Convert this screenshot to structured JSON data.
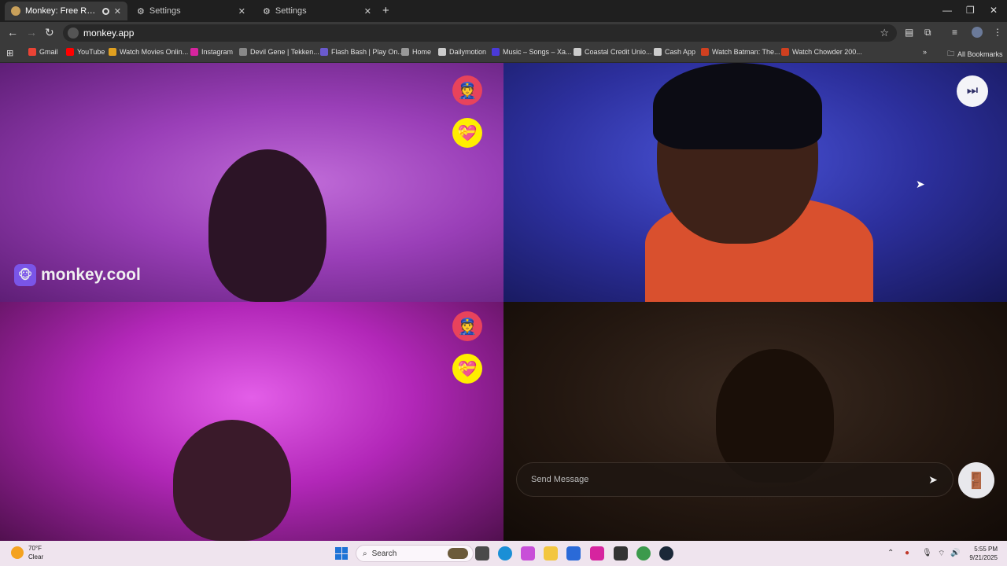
{
  "browser": {
    "tabs": [
      {
        "title": "Monkey: Free Random Vid",
        "active": true
      },
      {
        "title": "Settings",
        "active": false
      },
      {
        "title": "Settings",
        "active": false
      }
    ],
    "url": "monkey.app",
    "bookmarks": [
      {
        "label": "Gmail",
        "color": "#ea4335"
      },
      {
        "label": "YouTube",
        "color": "#ff0000"
      },
      {
        "label": "Watch Movies Onlin...",
        "color": "#e0a020"
      },
      {
        "label": "Instagram",
        "color": "#d6249f"
      },
      {
        "label": "Devil Gene | Tekken...",
        "color": "#888888"
      },
      {
        "label": "Flash Bash | Play On...",
        "color": "#6a5acd"
      },
      {
        "label": "Home",
        "color": "#999999"
      },
      {
        "label": "Dailymotion",
        "color": "#cccccc"
      },
      {
        "label": "Music – Songs – Xa...",
        "color": "#4a3ad8"
      },
      {
        "label": "Coastal Credit Unio...",
        "color": "#cccccc"
      },
      {
        "label": "Cash App",
        "color": "#cccccc"
      },
      {
        "label": "Watch Batman: The...",
        "color": "#d04020"
      },
      {
        "label": "Watch Chowder 200...",
        "color": "#d04020"
      }
    ],
    "all_bookmarks_label": "All Bookmarks"
  },
  "app": {
    "watermark": "monkey.cool",
    "chat_placeholder": "Send Message",
    "badges": {
      "police": "👮",
      "heart": "💝"
    }
  },
  "taskbar": {
    "weather_temp": "70°F",
    "weather_desc": "Clear",
    "search_label": "Search",
    "time": "5:55 PM",
    "date": "9/21/2025"
  }
}
